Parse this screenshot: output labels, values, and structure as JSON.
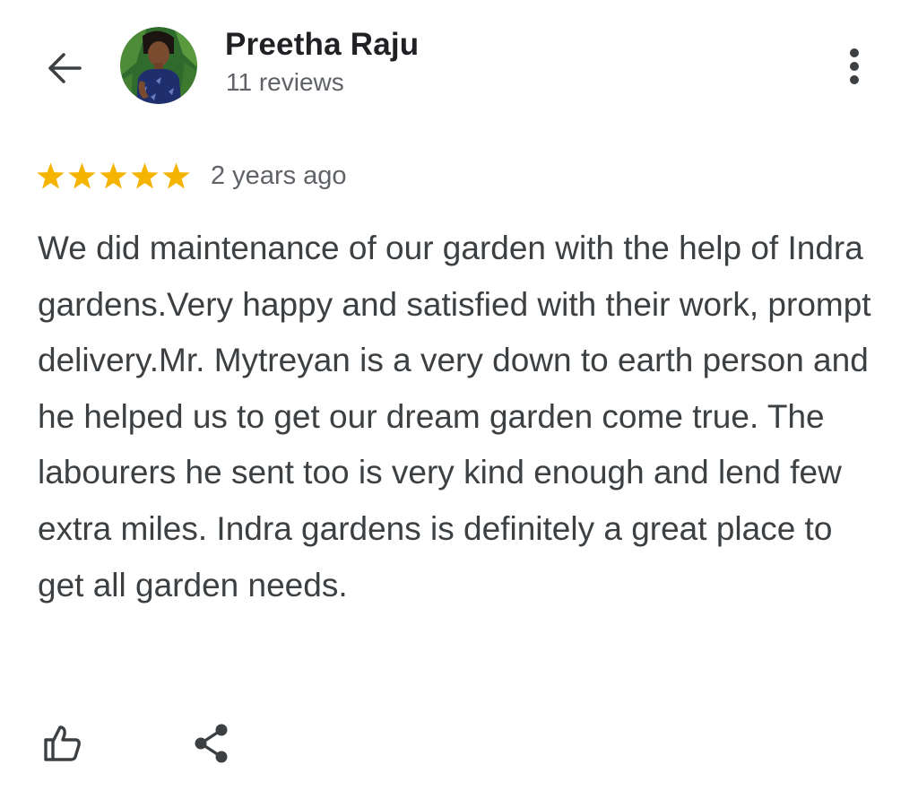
{
  "header": {
    "back_icon": "arrow-back-icon",
    "avatar_icon": "user-avatar",
    "user_name": "Preetha Raju",
    "review_count": "11 reviews",
    "more_icon": "more-vert-icon"
  },
  "review": {
    "rating": 5,
    "rating_max": 5,
    "star_color": "#f4b400",
    "timestamp": "2 years ago",
    "text": "We did maintenance of our garden with the help of Indra gardens.Very happy and satisfied with their work, prompt delivery.Mr. Mytreyan is a very down to earth person and he helped us to get our dream garden come true. The labourers he sent too is very kind enough and lend few extra miles. Indra gardens is definitely a great place to get all garden needs."
  },
  "actions": {
    "like_icon": "thumb-up-icon",
    "share_icon": "share-icon"
  },
  "colors": {
    "text_primary": "#202124",
    "text_body": "#3c4043",
    "text_secondary": "#5f6368",
    "star": "#f4b400"
  }
}
